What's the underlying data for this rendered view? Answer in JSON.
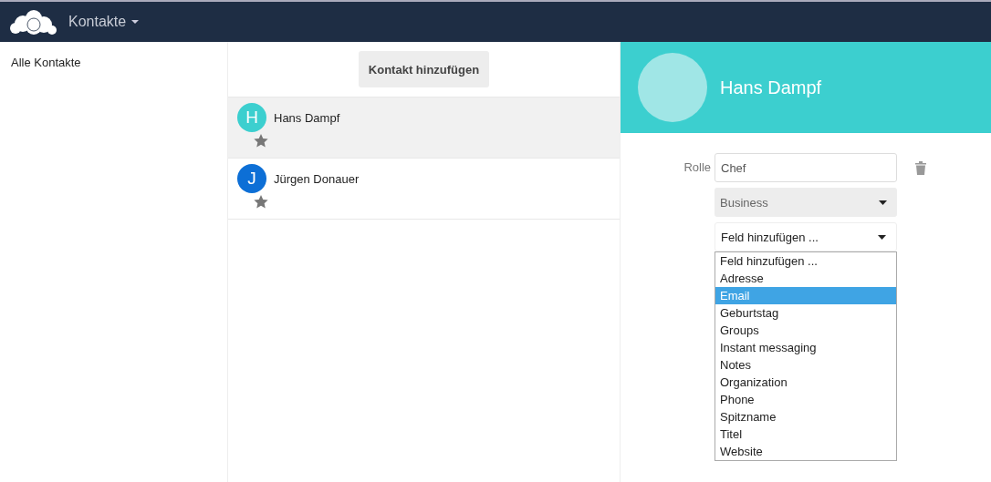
{
  "header": {
    "app_title": "Kontakte"
  },
  "sidebar": {
    "items": [
      {
        "label": "Alle Kontakte",
        "selected": false
      }
    ]
  },
  "add_button": "Kontakt hinzufügen",
  "contacts": [
    {
      "initial": "H",
      "name": "Hans Dampf",
      "color": "#3ccfcf",
      "selected": true,
      "favorite": false
    },
    {
      "initial": "J",
      "name": "Jürgen Donauer",
      "color": "#0d6fd6",
      "selected": false,
      "favorite": false
    }
  ],
  "detail": {
    "name": "Hans Dampf",
    "role_label": "Rolle",
    "role_value": "Chef",
    "type_select": "Business",
    "add_field_select": "Feld hinzufügen ...",
    "add_field_options": [
      {
        "label": "Feld hinzufügen ...",
        "selected": false
      },
      {
        "label": "Adresse",
        "selected": false
      },
      {
        "label": "Email",
        "selected": true
      },
      {
        "label": "Geburtstag",
        "selected": false
      },
      {
        "label": "Groups",
        "selected": false
      },
      {
        "label": "Instant messaging",
        "selected": false
      },
      {
        "label": "Notes",
        "selected": false
      },
      {
        "label": "Organization",
        "selected": false
      },
      {
        "label": "Phone",
        "selected": false
      },
      {
        "label": "Spitzname",
        "selected": false
      },
      {
        "label": "Titel",
        "selected": false
      },
      {
        "label": "Website",
        "selected": false
      }
    ]
  }
}
